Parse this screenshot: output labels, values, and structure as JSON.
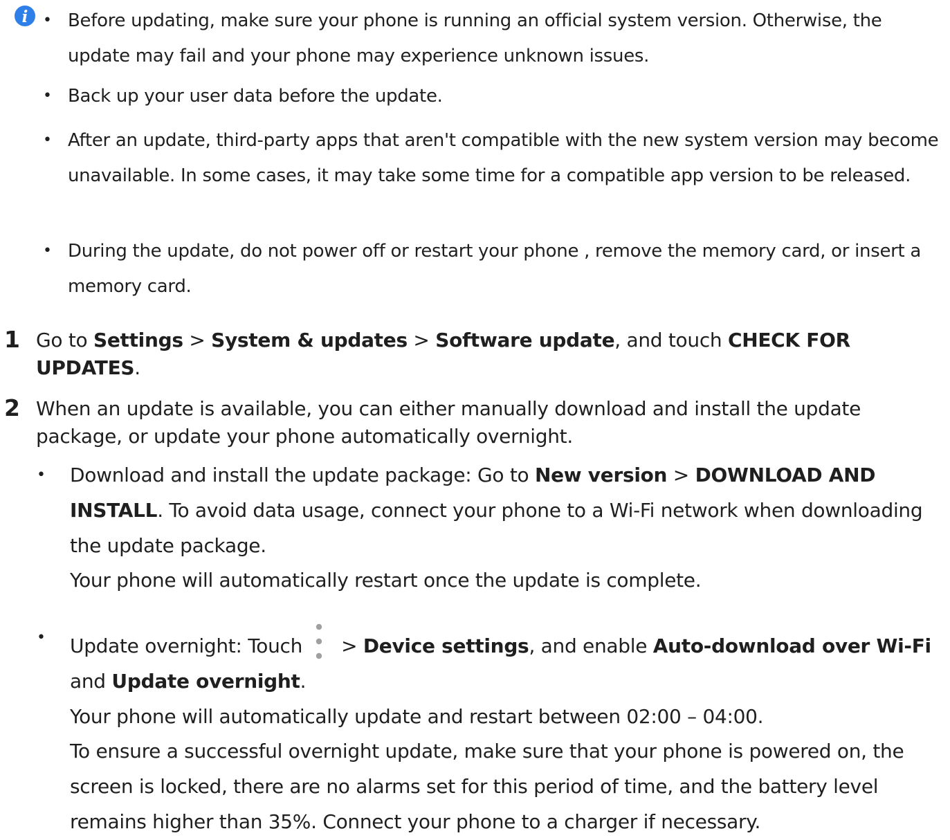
{
  "notes": [
    "Before updating, make sure your phone is running an official system version. Otherwise, the update may fail and your phone may experience unknown issues.",
    "Back up your user data before the update.",
    "After an update, third-party apps that aren't compatible with the new system version may become unavailable. In some cases, it may take some time for a compatible app version to be released.",
    "During the update, do not power off or restart your phone , remove the memory card, or insert a memory card."
  ],
  "bullet_char": "•",
  "icon_names": [
    "info-icon",
    "more-vertical-icon"
  ],
  "colors": {
    "info_icon": "#2f7fe8",
    "text": "#1f1f1f"
  },
  "steps": [
    {
      "number": "1",
      "text_1": "Go to ",
      "bold_1": "Settings",
      "text_2": " > ",
      "bold_2": "System & updates",
      "text_3": " > ",
      "bold_3": "Software update",
      "text_4": ", and touch ",
      "bold_4": "CHECK FOR UPDATES",
      "text_5": "."
    },
    {
      "number": "2",
      "text": "When an update is available, you can either manually download and install the update package, or update your phone automatically overnight."
    }
  ],
  "sub_items": [
    {
      "text_1": "Download and install the update package: Go to ",
      "bold_1": "New version",
      "text_2": " > ",
      "bold_2": "DOWNLOAD AND INSTALL",
      "text_3": ". To avoid data usage, connect your phone to a Wi-Fi network when downloading the update package.",
      "line_2": "Your phone will automatically restart once the update is complete."
    },
    {
      "text_1": "Update overnight: Touch",
      "text_2": "> ",
      "bold_1": "Device settings",
      "text_3": ", and enable ",
      "bold_2": "Auto-download over Wi-Fi",
      "text_4": " and ",
      "bold_3": "Update overnight",
      "text_5": ".",
      "line_2": "Your phone will automatically update and restart between 02:00 – 04:00.",
      "line_3": "To ensure a successful overnight update, make sure that your phone is powered on, the screen is locked, there are no alarms set for this period of time, and the battery level remains higher than 35%. Connect your phone to a charger if necessary."
    }
  ]
}
